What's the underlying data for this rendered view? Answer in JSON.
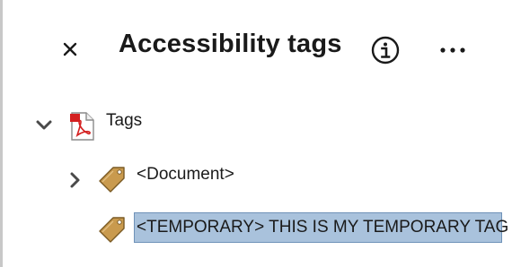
{
  "panel": {
    "title": "Accessibility tags"
  },
  "tree": {
    "root": {
      "label": "Tags",
      "expanded": true
    },
    "children": [
      {
        "label": "<Document>",
        "expanded": false
      },
      {
        "label": "<TEMPORARY> THIS IS MY TEMPORARY TAG",
        "selected": true
      }
    ]
  },
  "icons": {
    "close": "close-icon",
    "info": "info-icon",
    "more": "more-icon",
    "pdf": "pdf-file-icon",
    "tag": "tag-icon",
    "expanded": "chevron-down-icon",
    "collapsed": "chevron-right-icon"
  },
  "colors": {
    "selection": "#a9c2dc",
    "selection_border": "#6f92b8",
    "tag_fill": "#c99a4e",
    "pdf_red": "#d41f1f"
  }
}
